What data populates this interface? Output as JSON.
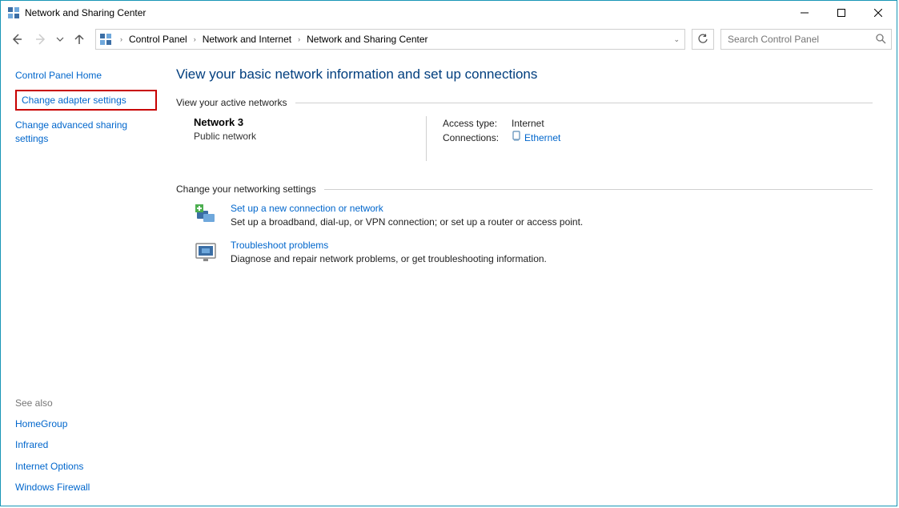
{
  "window": {
    "title": "Network and Sharing Center"
  },
  "breadcrumb": {
    "items": [
      "Control Panel",
      "Network and Internet",
      "Network and Sharing Center"
    ]
  },
  "search": {
    "placeholder": "Search Control Panel"
  },
  "sidebar": {
    "home": "Control Panel Home",
    "adapter": "Change adapter settings",
    "advanced": "Change advanced sharing settings",
    "see_also_label": "See also",
    "see_also": [
      "HomeGroup",
      "Infrared",
      "Internet Options",
      "Windows Firewall"
    ]
  },
  "main": {
    "title": "View your basic network information and set up connections",
    "active_header": "View your active networks",
    "network": {
      "name": "Network  3",
      "type": "Public network",
      "access_label": "Access type:",
      "access_value": "Internet",
      "connections_label": "Connections:",
      "connections_value": "Ethernet"
    },
    "change_header": "Change your networking settings",
    "setup": {
      "link": "Set up a new connection or network",
      "desc": "Set up a broadband, dial-up, or VPN connection; or set up a router or access point."
    },
    "troubleshoot": {
      "link": "Troubleshoot problems",
      "desc": "Diagnose and repair network problems, or get troubleshooting information."
    }
  }
}
